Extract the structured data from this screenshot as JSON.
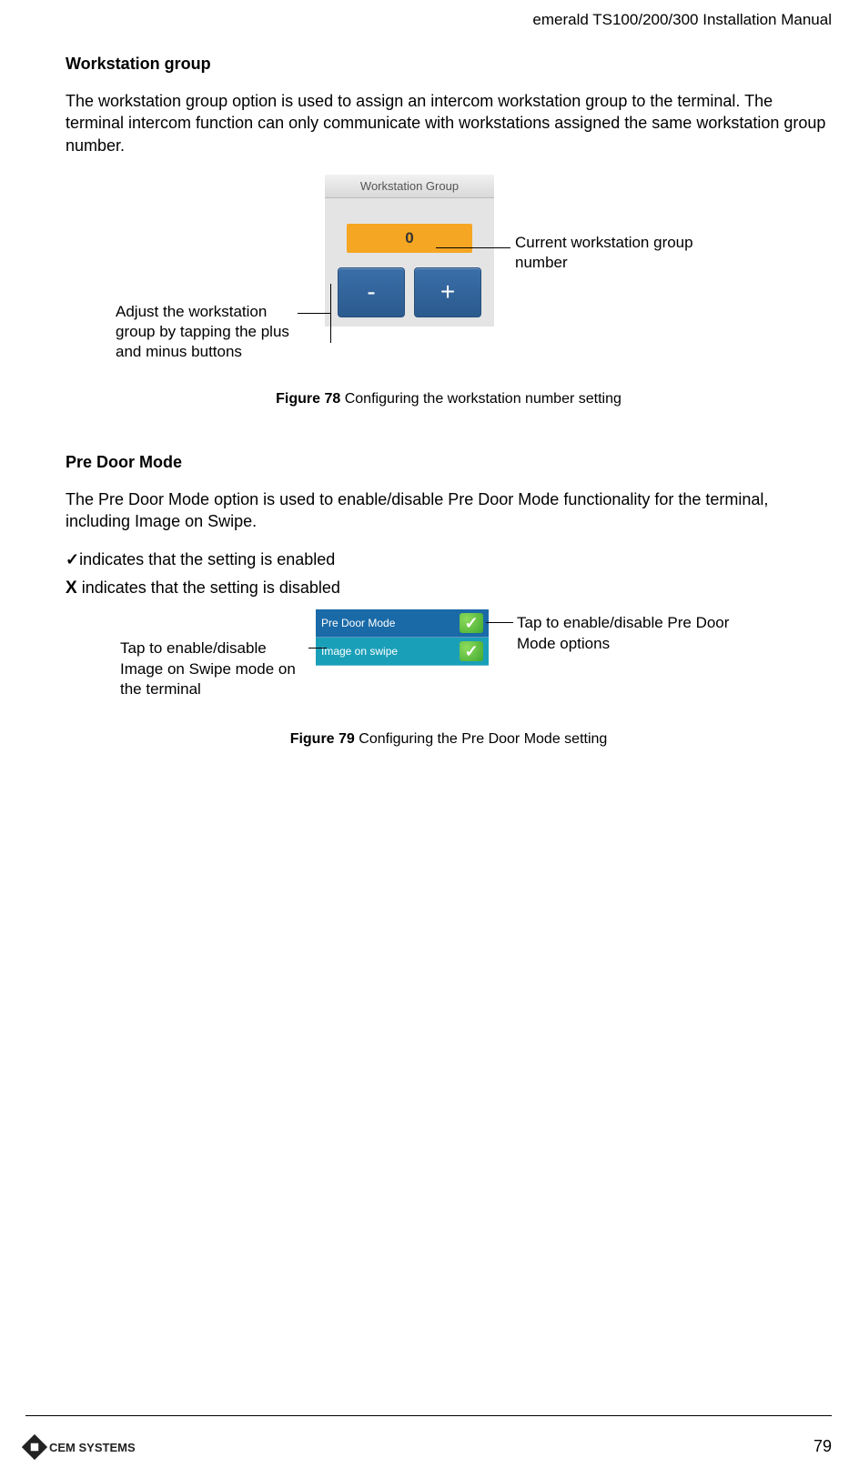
{
  "header": {
    "doc_title": "emerald TS100/200/300 Installation Manual"
  },
  "section1": {
    "heading": "Workstation group",
    "para": "The workstation group option is used to assign an intercom workstation group to the terminal. The terminal intercom function can only communicate with workstations assigned the same workstation group number.",
    "device_title": "Workstation Group",
    "device_value": "0",
    "minus": "-",
    "plus": "+",
    "callout_left": "Adjust the workstation group by tapping the plus and minus buttons",
    "callout_right": "Current workstation group number",
    "caption_label": "Figure 78",
    "caption_text": " Configuring the workstation number setting"
  },
  "section2": {
    "heading": "Pre Door Mode",
    "para": "The Pre Door Mode option is used to enable/disable Pre Door Mode functionality for the terminal, including Image on Swipe.",
    "check_glyph": "✓",
    "enabled_text": "indicates that the setting is enabled",
    "x_glyph": "X",
    "disabled_text": " indicates that the setting is disabled",
    "row1_label": "Pre Door Mode",
    "row2_label": "Image on swipe",
    "check_icon": "✓",
    "callout_left": "Tap to enable/disable Image on Swipe mode on the terminal",
    "callout_right": "Tap to enable/disable Pre Door Mode options",
    "caption_label": "Figure 79",
    "caption_text": " Configuring the Pre Door Mode setting"
  },
  "footer": {
    "logo_text": "CEM SYSTEMS",
    "page": "79"
  }
}
